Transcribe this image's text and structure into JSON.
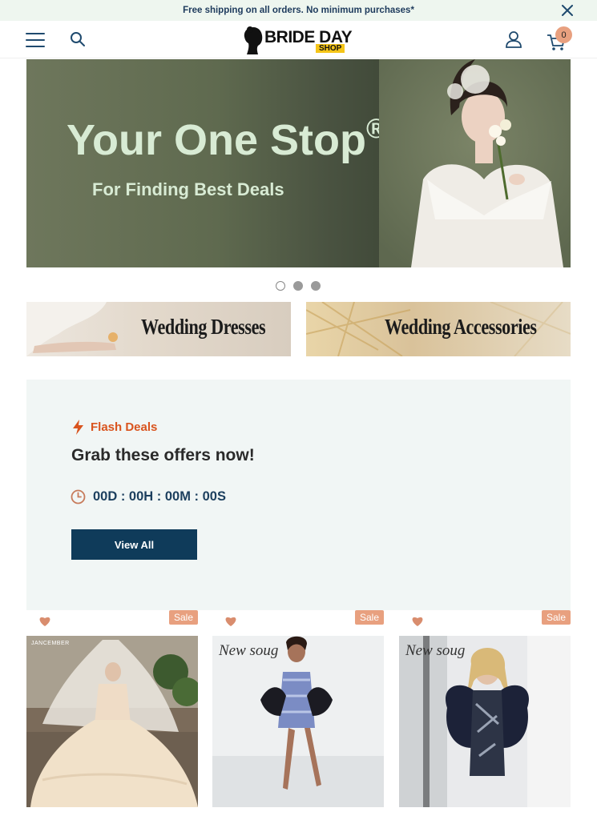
{
  "announcement": {
    "text": "Free shipping on all orders. No minimum purchases*",
    "close_icon": "close-icon"
  },
  "header": {
    "menu_icon": "hamburger-menu-icon",
    "search_icon": "search-icon",
    "logo": {
      "text": "BRIDE DAY",
      "sub": "SHOP"
    },
    "account_icon": "user-account-icon",
    "cart_icon": "shopping-cart-icon",
    "cart_count": "0"
  },
  "hero": {
    "title": "Your One Stop",
    "title_mark": "®",
    "subtitle": "For Finding Best Deals",
    "slides": 3,
    "active_slide": 1
  },
  "categories": [
    {
      "label": "Wedding Dresses"
    },
    {
      "label": "Wedding Accessories"
    }
  ],
  "flash_deals": {
    "label": "Flash Deals",
    "title": "Grab these offers now!",
    "countdown": "00D :  00H :  00M :  00S",
    "view_all": "View All"
  },
  "products": [
    {
      "badge": "Sale",
      "brand": "JANCEMBER"
    },
    {
      "badge": "Sale",
      "brand": "New soug"
    },
    {
      "badge": "Sale",
      "brand": "New soug"
    }
  ],
  "colors": {
    "accent": "#e8a07f",
    "primary": "#0f3b5a",
    "flash": "#d9541e",
    "hero_text": "#d8ebd4"
  }
}
